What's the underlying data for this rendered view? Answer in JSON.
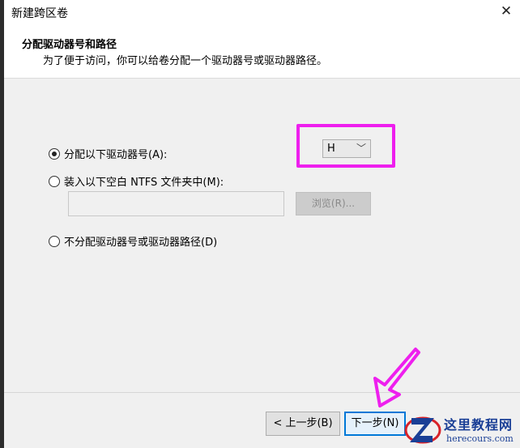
{
  "window": {
    "title": "新建跨区卷",
    "close_glyph": "✕"
  },
  "header": {
    "title": "分配驱动器号和路径",
    "subtitle": "为了便于访问，你可以给卷分配一个驱动器号或驱动器路径。"
  },
  "options": {
    "assign_letter": {
      "label": "分配以下驱动器号(A):",
      "checked": true
    },
    "mount_folder": {
      "label": "装入以下空白 NTFS 文件夹中(M):",
      "checked": false
    },
    "no_assign": {
      "label": "不分配驱动器号或驱动器路径(D)",
      "checked": false
    }
  },
  "drive_letter": {
    "selected": "H",
    "chevron": "﹀"
  },
  "mount_path": {
    "value": "",
    "browse_label": "浏览(R)..."
  },
  "footer": {
    "back_label": "< 上一步(B)",
    "next_label": "下一步(N)"
  },
  "watermark": {
    "name": "这里教程网",
    "url": "herecours.com"
  },
  "colors": {
    "highlight": "#ee1fee",
    "accent": "#0078d7",
    "watermark_blue": "#1a3f96",
    "watermark_red": "#d8232a"
  }
}
